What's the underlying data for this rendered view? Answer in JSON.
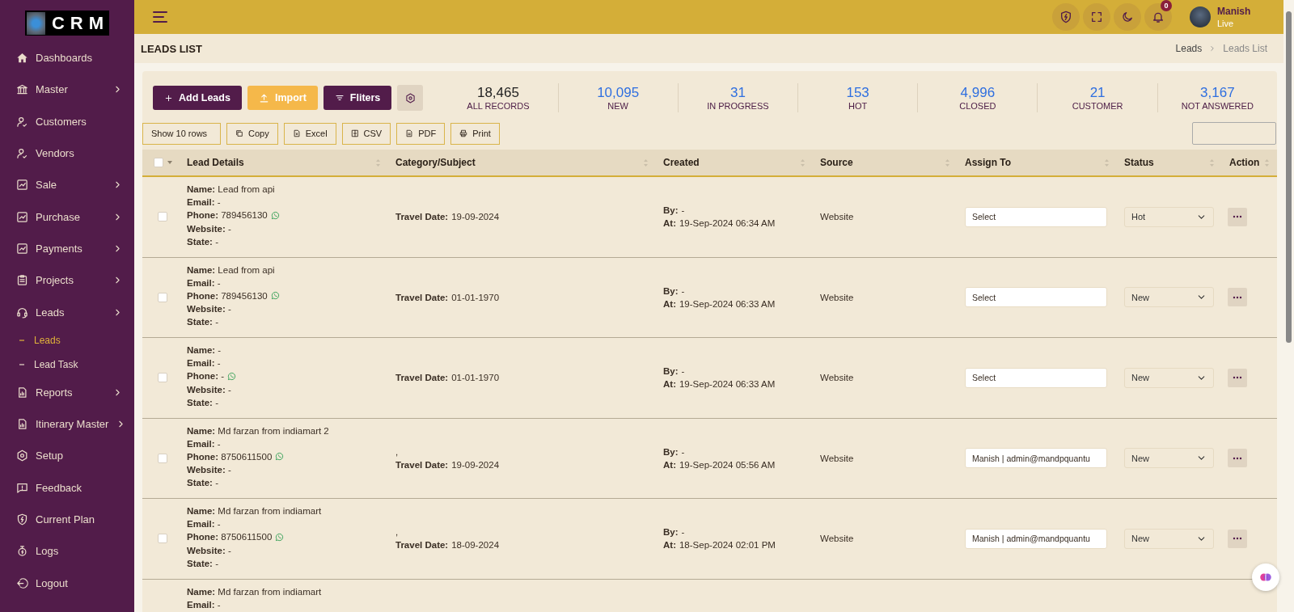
{
  "sidebar": {
    "logo": "CRM",
    "items": [
      {
        "label": "Dashboards",
        "submenu": false,
        "selected": false
      },
      {
        "label": "Master",
        "submenu": true,
        "selected": false
      },
      {
        "label": "Customers",
        "submenu": false,
        "selected": false
      },
      {
        "label": "Vendors",
        "submenu": false,
        "selected": false
      },
      {
        "label": "Sale",
        "submenu": true,
        "selected": false
      },
      {
        "label": "Purchase",
        "submenu": true,
        "selected": false
      },
      {
        "label": "Payments",
        "submenu": true,
        "selected": false
      },
      {
        "label": "Projects",
        "submenu": true,
        "selected": false
      },
      {
        "label": "Leads",
        "submenu": true,
        "selected": false,
        "children": [
          {
            "label": "Leads",
            "selected": true
          },
          {
            "label": "Lead Task",
            "selected": false
          }
        ]
      },
      {
        "label": "Reports",
        "submenu": true,
        "selected": false
      },
      {
        "label": "Itinerary Master",
        "submenu": true,
        "selected": false
      },
      {
        "label": "Setup",
        "submenu": false,
        "selected": false
      },
      {
        "label": "Feedback",
        "submenu": false,
        "selected": false
      },
      {
        "label": "Current Plan",
        "submenu": false,
        "selected": false
      },
      {
        "label": "Logs",
        "submenu": false,
        "selected": false
      },
      {
        "label": "Logout",
        "submenu": false,
        "selected": false
      }
    ]
  },
  "topbar": {
    "notification_count": "0",
    "user": {
      "name": "Manish",
      "status": "Live"
    }
  },
  "page_header": {
    "title": "LEADS LIST",
    "breadcrumb": [
      "Leads",
      "Leads List"
    ]
  },
  "actions": [
    {
      "kind": "add",
      "label": "Add Leads"
    },
    {
      "kind": "import",
      "label": "Import"
    },
    {
      "kind": "filter",
      "label": "Fliters"
    },
    {
      "kind": "settings"
    }
  ],
  "stats": [
    {
      "value": "18,465",
      "label": "ALL RECORDS",
      "color": "#222222"
    },
    {
      "value": "10,095",
      "label": "NEW",
      "color": "#2f6fe0"
    },
    {
      "value": "31",
      "label": "IN PROGRESS",
      "color": "#2f6fe0"
    },
    {
      "value": "153",
      "label": "HOT",
      "color": "#2f6fe0"
    },
    {
      "value": "4,996",
      "label": "CLOSED",
      "color": "#2f6fe0"
    },
    {
      "value": "21",
      "label": "CUSTOMER",
      "color": "#2f6fe0"
    },
    {
      "value": "3,167",
      "label": "NOT ANSWERED",
      "color": "#2f6fe0"
    }
  ],
  "toolbar": {
    "page_size": "Show 10 rows",
    "exports": [
      "Copy",
      "Excel",
      "CSV",
      "PDF",
      "Print"
    ]
  },
  "table": {
    "select_all_checked": false,
    "columns": [
      "Lead Details",
      "Category/Subject",
      "Created",
      "Source",
      "Assign To",
      "Status",
      "Action"
    ],
    "rows": [
      {
        "checked": false,
        "lead_details": [
          "**Name:** Lead from api",
          "**Email:** -",
          "**Phone:** 789456130",
          "**Website:** -",
          "**State:** -"
        ],
        "whatsapp": true,
        "category": [
          "**Travel Date:** 19-09-2024"
        ],
        "created": [
          "**By:** -",
          "**At:** 19-Sep-2024 06:34 AM"
        ],
        "source": "Website",
        "assign_to": "Select",
        "status": "Hot"
      },
      {
        "checked": false,
        "lead_details": [
          "**Name:** Lead from api",
          "**Email:** -",
          "**Phone:** 789456130",
          "**Website:** -",
          "**State:** -"
        ],
        "whatsapp": true,
        "category": [
          "**Travel Date:** 01-01-1970"
        ],
        "created": [
          "**By:** -",
          "**At:** 19-Sep-2024 06:33 AM"
        ],
        "source": "Website",
        "assign_to": "Select",
        "status": "New"
      },
      {
        "checked": false,
        "lead_details": [
          "**Name:** -",
          "**Email:** -",
          "**Phone:** -",
          "**Website:** -",
          "**State:** -"
        ],
        "whatsapp": true,
        "category": [
          "**Travel Date:** 01-01-1970"
        ],
        "created": [
          "**By:** -",
          "**At:** 19-Sep-2024 06:33 AM"
        ],
        "source": "Website",
        "assign_to": "Select",
        "status": "New"
      },
      {
        "checked": false,
        "lead_details": [
          "**Name:** Md farzan from indiamart 2",
          "**Email:** -",
          "**Phone:** 8750611500",
          "**Website:** -",
          "**State:** -"
        ],
        "whatsapp": true,
        "category": [
          ",",
          "**Travel Date:** 19-09-2024"
        ],
        "created": [
          "**By:** -",
          "**At:** 19-Sep-2024 05:56 AM"
        ],
        "source": "Website",
        "assign_to": "Manish | admin@mandpquantu",
        "status": "New"
      },
      {
        "checked": false,
        "lead_details": [
          "**Name:** Md farzan from indiamart",
          "**Email:** -",
          "**Phone:** 8750611500",
          "**Website:** -",
          "**State:** -"
        ],
        "whatsapp": true,
        "category": [
          ",",
          "**Travel Date:** 18-09-2024"
        ],
        "created": [
          "**By:** -",
          "**At:** 18-Sep-2024 02:01 PM"
        ],
        "source": "Website",
        "assign_to": "Manish | admin@mandpquantu",
        "status": "New"
      },
      {
        "lead_details": [
          "**Name:** Md farzan from indiamart",
          "**Email:** -"
        ]
      }
    ]
  }
}
